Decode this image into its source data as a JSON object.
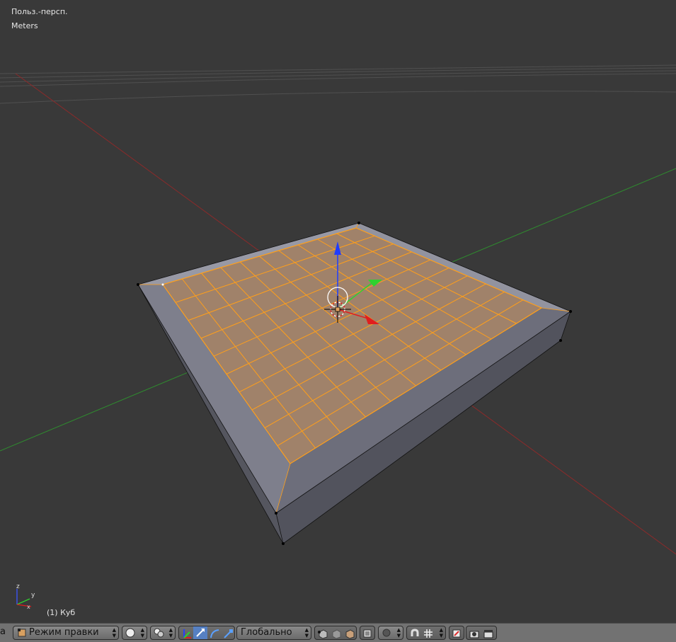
{
  "viewport": {
    "view_name": "Польз.-персп.",
    "units": "Meters",
    "object_info": "(1) Куб",
    "axes": {
      "z_label": "z",
      "y_label": "y",
      "x_label": "x"
    }
  },
  "header": {
    "cut_text": "a",
    "mode_label": "Режим правки",
    "orientation_label": "Глобально"
  },
  "colors": {
    "background": "#393939",
    "x_axis": "#8b2a2a",
    "y_axis": "#2f8b2f",
    "selected_face": "#a0826a",
    "selected_edge": "#ff9f1a",
    "mesh_side": "#6a6c7a",
    "manipulator_z": "#1f3cff",
    "manipulator_y": "#2fd22f",
    "manipulator_x": "#e01e1e"
  },
  "icons": {
    "mode": "edit-mode-icon",
    "shading": "solid-sphere-icon",
    "pivot": "pivot-point-icon",
    "manipulator": "manipulator-icon",
    "translate": "translate-arrow-icon",
    "rotate": "rotate-icon",
    "scale": "scale-icon",
    "vertex_select": "vertex-select-icon",
    "edge_select": "edge-select-icon",
    "face_select": "face-select-icon",
    "limit_visible": "limit-selection-icon",
    "proportional": "proportional-edit-icon",
    "snap": "magnet-icon",
    "snap_target": "snap-target-icon",
    "opengl_render": "camera-render-icon",
    "anim_render": "clapper-icon"
  }
}
